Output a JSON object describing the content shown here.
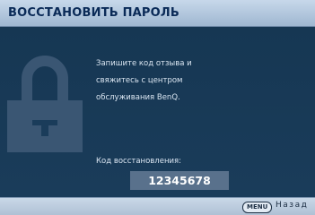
{
  "window": {
    "title": "ВОССТАНОВИТЬ ПАРОЛЬ"
  },
  "message": {
    "line1": "Запишите код отзыва и",
    "line2": "свяжитесь с центром",
    "line3": "обслуживания BenQ."
  },
  "recovery": {
    "label": "Код восстановления:",
    "code": "12345678"
  },
  "footer": {
    "menu_key": "MENU",
    "back_label": "Назад"
  },
  "icons": {
    "background": "lock-icon"
  },
  "colors": {
    "title_bg": "#b4c8de",
    "title_text": "#0a2a57",
    "body_bg": "#1a3c5a",
    "code_box_bg": "#59718c",
    "text": "#dbe6f2"
  }
}
